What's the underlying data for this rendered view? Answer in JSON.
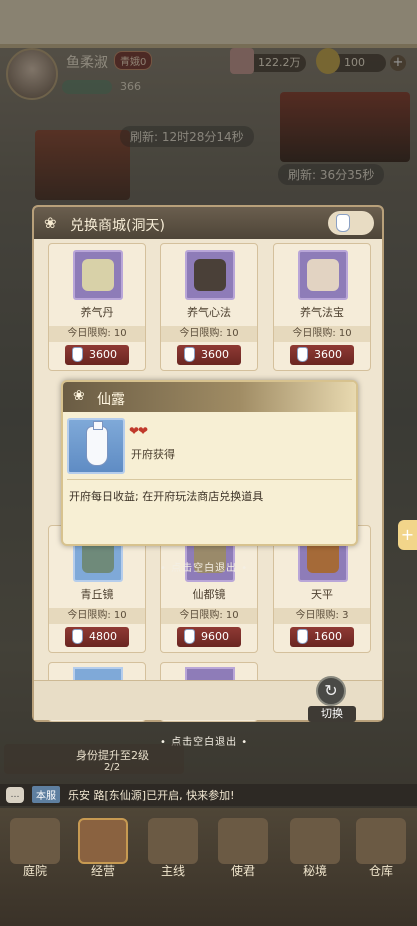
{
  "player": {
    "name": "鱼柔淑",
    "rank": "青娥0",
    "status_value": "366"
  },
  "resources": [
    {
      "icon": "ticket-icon",
      "value": "122.2万"
    },
    {
      "icon": "ingot-icon",
      "value": "100"
    }
  ],
  "refresh": [
    {
      "label": "刷新: 12时28分14秒"
    },
    {
      "label": "刷新: 36分35秒"
    }
  ],
  "shop": {
    "title": "兑换商城(洞天)",
    "items": [
      {
        "name": "养气丹",
        "limit": "今日限购: 10",
        "price": "3600",
        "thumb_color": "#d8d1a8"
      },
      {
        "name": "养气心法",
        "limit": "今日限购: 10",
        "price": "3600",
        "thumb_color": "#4a4038"
      },
      {
        "name": "养气法宝",
        "limit": "今日限购: 10",
        "price": "3600",
        "thumb_color": "#e2d3c2"
      },
      {
        "name": "青丘镜",
        "limit": "今日限购: 10",
        "price": "4800",
        "thumb_color": "#6f8a7a"
      },
      {
        "name": "仙都镜",
        "limit": "今日限购: 10",
        "price": "9600",
        "thumb_color": "#9a8a6a"
      },
      {
        "name": "天平",
        "limit": "今日限购: 3",
        "price": "1600",
        "thumb_color": "#a56a38"
      }
    ],
    "switch_label": "切换"
  },
  "popup": {
    "title": "仙露",
    "hearts": "❤❤",
    "source": "开府获得",
    "description": "开府每日收益; 在开府玩法商店兑换道具"
  },
  "hints": {
    "upper": "• 点击空白退出 •",
    "lower": "• 点击空白退出 •"
  },
  "task": {
    "text": "身份提升至2级",
    "progress": "2/2"
  },
  "chat": {
    "channel": "本服",
    "message": "乐安 路[东仙源]已开启, 快来参加!"
  },
  "nav": [
    {
      "label": "庭院",
      "icon": "courtyard-icon"
    },
    {
      "label": "经营",
      "icon": "business-icon"
    },
    {
      "label": "主线",
      "icon": "mainline-icon"
    },
    {
      "label": "使君",
      "icon": "envoy-icon"
    },
    {
      "label": "秘境",
      "icon": "secret-realm-icon"
    },
    {
      "label": "仓库",
      "icon": "warehouse-icon"
    }
  ],
  "colors": {
    "price_button": "#8f3a34",
    "panel_bg": "#efe5d0",
    "item_frame_purple": "#8e7cb8",
    "item_frame_blue": "#7fa9d8"
  }
}
